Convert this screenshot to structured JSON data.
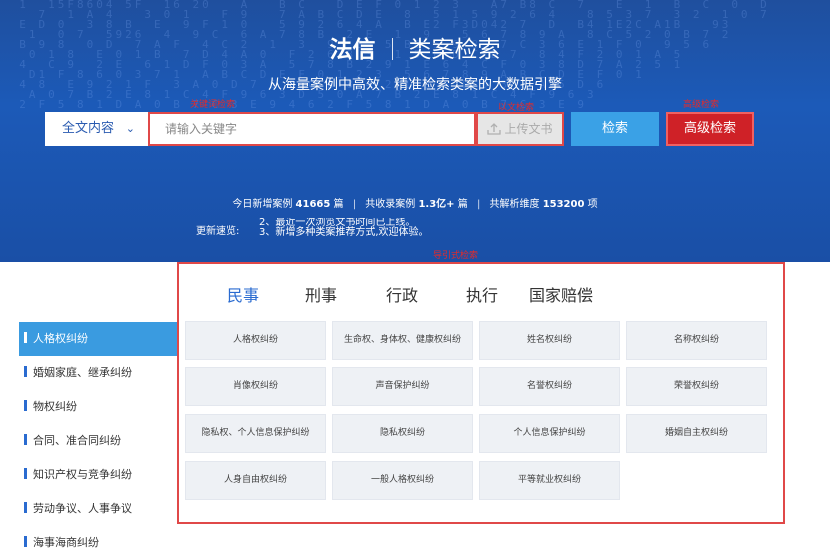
{
  "header": {
    "brand": "法信",
    "product": "类案检索",
    "tagline": "从海量案例中高效、精准检索类案的大数据引擎"
  },
  "search": {
    "scope_label": "全文内容",
    "placeholder": "请输入关键字",
    "upload_label": "上传文书",
    "search_label": "检索",
    "advanced_label": "高级检索"
  },
  "annotations": {
    "keyword": "关键词检索",
    "upload": "以文检索",
    "advanced": "高级检索",
    "guided": "导引式检索"
  },
  "stats": {
    "new_label": "今日新增案例",
    "new_count": "41665",
    "new_unit": "篇",
    "total_label": "共收录案例",
    "total_count": "1.3亿+",
    "total_unit": "篇",
    "dims_label": "共解析维度",
    "dims_count": "153200",
    "dims_unit": "项"
  },
  "updates": {
    "label": "更新速览:",
    "line1": "2、最近一次浏览文书时间已上线。",
    "line2": "3、新增多种类案推荐方式,欢迎体验。"
  },
  "tabs": [
    "民事",
    "刑事",
    "行政",
    "执行",
    "国家赔偿"
  ],
  "sidebar": [
    "人格权纠纷",
    "婚姻家庭、继承纠纷",
    "物权纠纷",
    "合同、准合同纠纷",
    "知识产权与竞争纠纷",
    "劳动争议、人事争议",
    "海事海商纠纷"
  ],
  "categories": [
    "人格权纠纷",
    "生命权、身体权、健康权纠纷",
    "姓名权纠纷",
    "名称权纠纷",
    "肖像权纠纷",
    "声音保护纠纷",
    "名誉权纠纷",
    "荣誉权纠纷",
    "隐私权、个人信息保护纠纷",
    "隐私权纠纷",
    "个人信息保护纠纷",
    "婚姻自主权纠纷",
    "人身自由权纠纷",
    "一般人格权纠纷",
    "平等就业权纠纷"
  ],
  "colors": {
    "hero_bg": "#1c5ab8",
    "accent_blue": "#2a6bd0",
    "search_btn": "#3aa1e6",
    "advanced_btn": "#cf2127",
    "annotation_red": "#e04848"
  },
  "icons": {
    "scope_dropdown": "chevron-down-icon",
    "upload": "upload-icon"
  }
}
